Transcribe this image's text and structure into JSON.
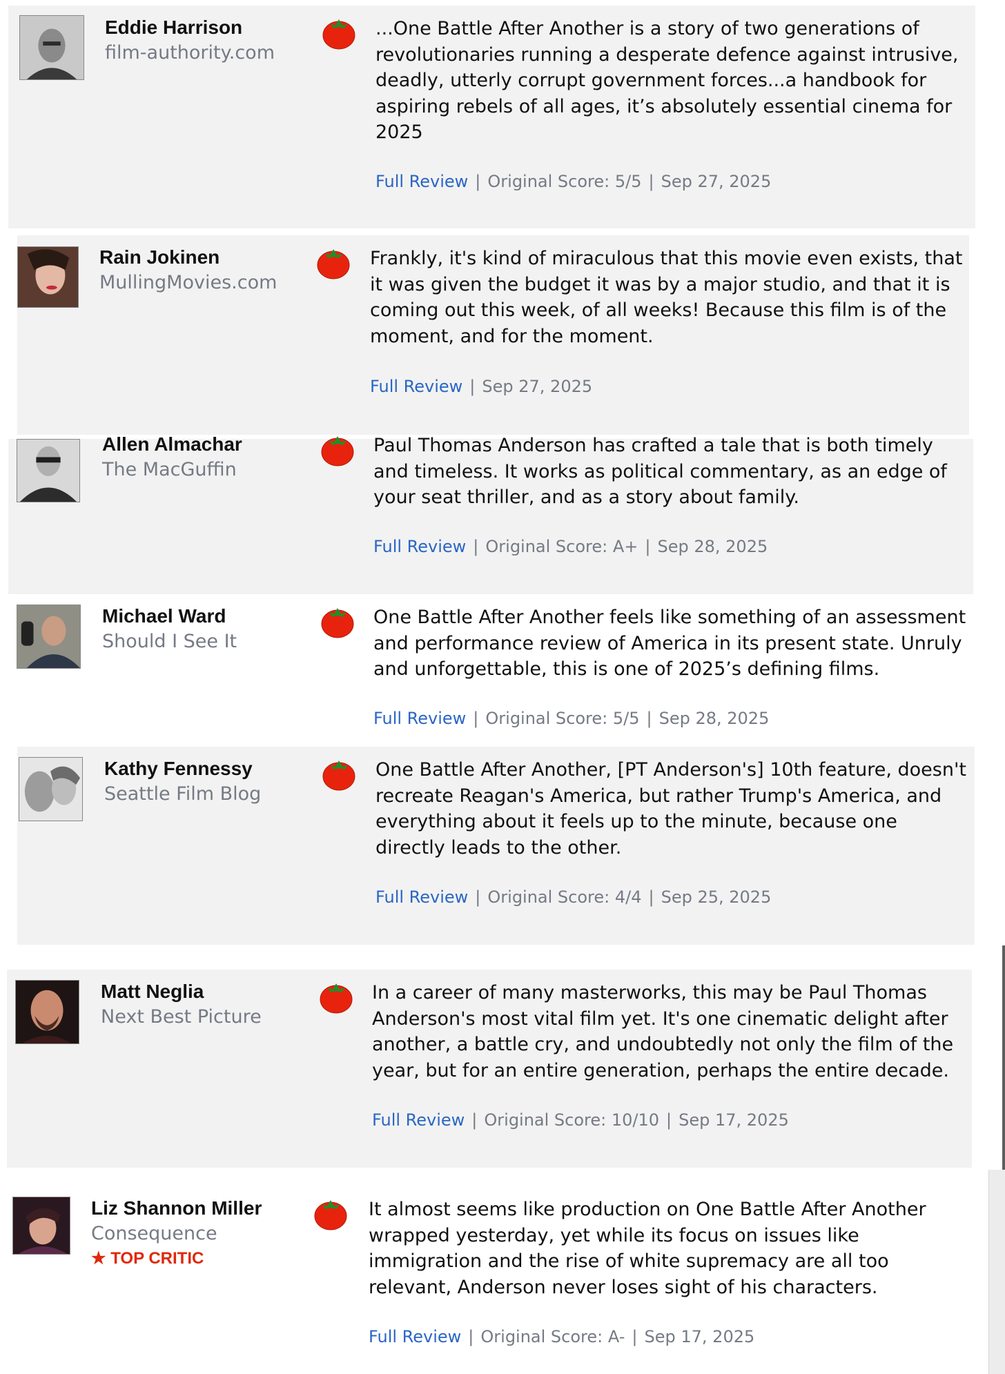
{
  "colors": {
    "card_grey": "#f2f2f2",
    "card_white": "#ffffff",
    "link_blue": "#2a66c4",
    "muted_grey": "#757a84",
    "top_critic_red": "#e0280c",
    "tomato_red": "#e8230d",
    "tomato_green": "#1f8f2b"
  },
  "reviews": [
    {
      "critic": "Eddie Harrison",
      "publication": "film-authority.com",
      "avatar_icon": "critic-photo-icon",
      "rating_icon": "fresh-tomato-icon",
      "quote": "...One Battle After Another is a story of two generations of revolutionaries running a desperate defence against intrusive, deadly, utterly corrupt government forces...a handbook for aspiring rebels of all ages, it’s absolutely essential cinema for 2025",
      "full_review": "Full Review",
      "separator": "|",
      "original_score": "Original Score: 5/5",
      "date": "Sep 27, 2025"
    },
    {
      "critic": "Rain Jokinen",
      "publication": "MullingMovies.com",
      "avatar_icon": "critic-photo-icon",
      "rating_icon": "fresh-tomato-icon",
      "quote": "Frankly, it's kind of miraculous that this movie even exists, that it was given the budget it was by a major studio, and that it is coming out this week, of all weeks! Because this film is of the moment, and for the moment.",
      "full_review": "Full Review",
      "separator": "|",
      "date": "Sep 27, 2025"
    },
    {
      "critic": "Allen Almachar",
      "publication": "The MacGuffin",
      "avatar_icon": "critic-photo-icon",
      "rating_icon": "fresh-tomato-icon",
      "quote": "Paul Thomas Anderson has crafted a tale that is both timely and timeless. It works as political commentary, as an edge of your seat thriller, and as a story about family.",
      "full_review": "Full Review",
      "separator": "|",
      "original_score": "Original Score: A+",
      "date": "Sep 28, 2025"
    },
    {
      "critic": "Michael Ward",
      "publication": "Should I See It",
      "avatar_icon": "critic-photo-icon",
      "rating_icon": "fresh-tomato-icon",
      "quote": "One Battle After Another feels like something of an assessment and performance review of America in its present state. Unruly and unforgettable, this is one of 2025’s defining films.",
      "full_review": "Full Review",
      "separator": "|",
      "original_score": "Original Score: 5/5",
      "date": "Sep 28, 2025"
    },
    {
      "critic": "Kathy Fennessy",
      "publication": "Seattle Film Blog",
      "avatar_icon": "critic-photo-icon",
      "rating_icon": "fresh-tomato-icon",
      "quote": "One Battle After Another, [PT Anderson's] 10th feature, doesn't recreate Reagan's America, but rather Trump's America, and everything about it feels up to the minute, because one directly leads to the other.",
      "full_review": "Full Review",
      "separator": "|",
      "original_score": "Original Score: 4/4",
      "date": "Sep 25, 2025"
    },
    {
      "critic": "Matt Neglia",
      "publication": "Next Best Picture",
      "avatar_icon": "critic-photo-icon",
      "rating_icon": "fresh-tomato-icon",
      "quote": "In a career of many masterworks, this may be Paul Thomas Anderson's most vital film yet. It's one cinematic delight after another, a battle cry, and undoubtedly not only the film of the year, but for an entire generation, perhaps the entire decade.",
      "full_review": "Full Review",
      "separator": "|",
      "original_score": "Original Score: 10/10",
      "date": "Sep 17, 2025"
    },
    {
      "critic": "Liz Shannon Miller",
      "publication": "Consequence",
      "top_critic_icon": "star-icon",
      "top_critic": "TOP CRITIC",
      "avatar_icon": "critic-photo-icon",
      "rating_icon": "fresh-tomato-icon",
      "quote": "It almost seems like production on One Battle After Another wrapped yesterday, yet while its focus on issues like immigration and the rise of white supremacy are all too relevant, Anderson never loses sight of his characters.",
      "full_review": "Full Review",
      "separator": "|",
      "original_score": "Original Score: A-",
      "date": "Sep 17, 2025"
    }
  ]
}
